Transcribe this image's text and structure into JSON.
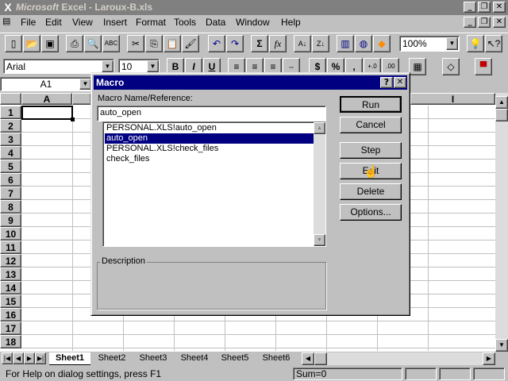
{
  "window": {
    "title_brand": "Microsoft",
    "title_rest": " Excel - Laroux-B.xls"
  },
  "menu": [
    "File",
    "Edit",
    "View",
    "Insert",
    "Format",
    "Tools",
    "Data",
    "Window",
    "Help"
  ],
  "toolbar": {
    "zoom": "100%",
    "font": "Arial",
    "size": "10"
  },
  "name_box": "A1",
  "columns": [
    "A",
    "I"
  ],
  "rows": [
    "1",
    "2",
    "3",
    "4",
    "5",
    "6",
    "7",
    "8",
    "9",
    "10",
    "11",
    "12",
    "13",
    "14",
    "15",
    "16",
    "17",
    "18"
  ],
  "dialog": {
    "title": "Macro",
    "name_label": "Macro Name/Reference:",
    "name_value": "auto_open",
    "macros": [
      "PERSONAL.XLS!auto_open",
      "auto_open",
      "PERSONAL.XLS!check_files",
      "check_files"
    ],
    "selected_index": 1,
    "description_label": "Description",
    "buttons": {
      "run": "Run",
      "cancel": "Cancel",
      "step": "Step",
      "edit": "Edit",
      "delete": "Delete",
      "options": "Options..."
    }
  },
  "sheets": [
    "Sheet1",
    "Sheet2",
    "Sheet3",
    "Sheet4",
    "Sheet5",
    "Sheet6"
  ],
  "status": {
    "help": "For Help on dialog settings, press F1",
    "sum": "Sum=0"
  }
}
